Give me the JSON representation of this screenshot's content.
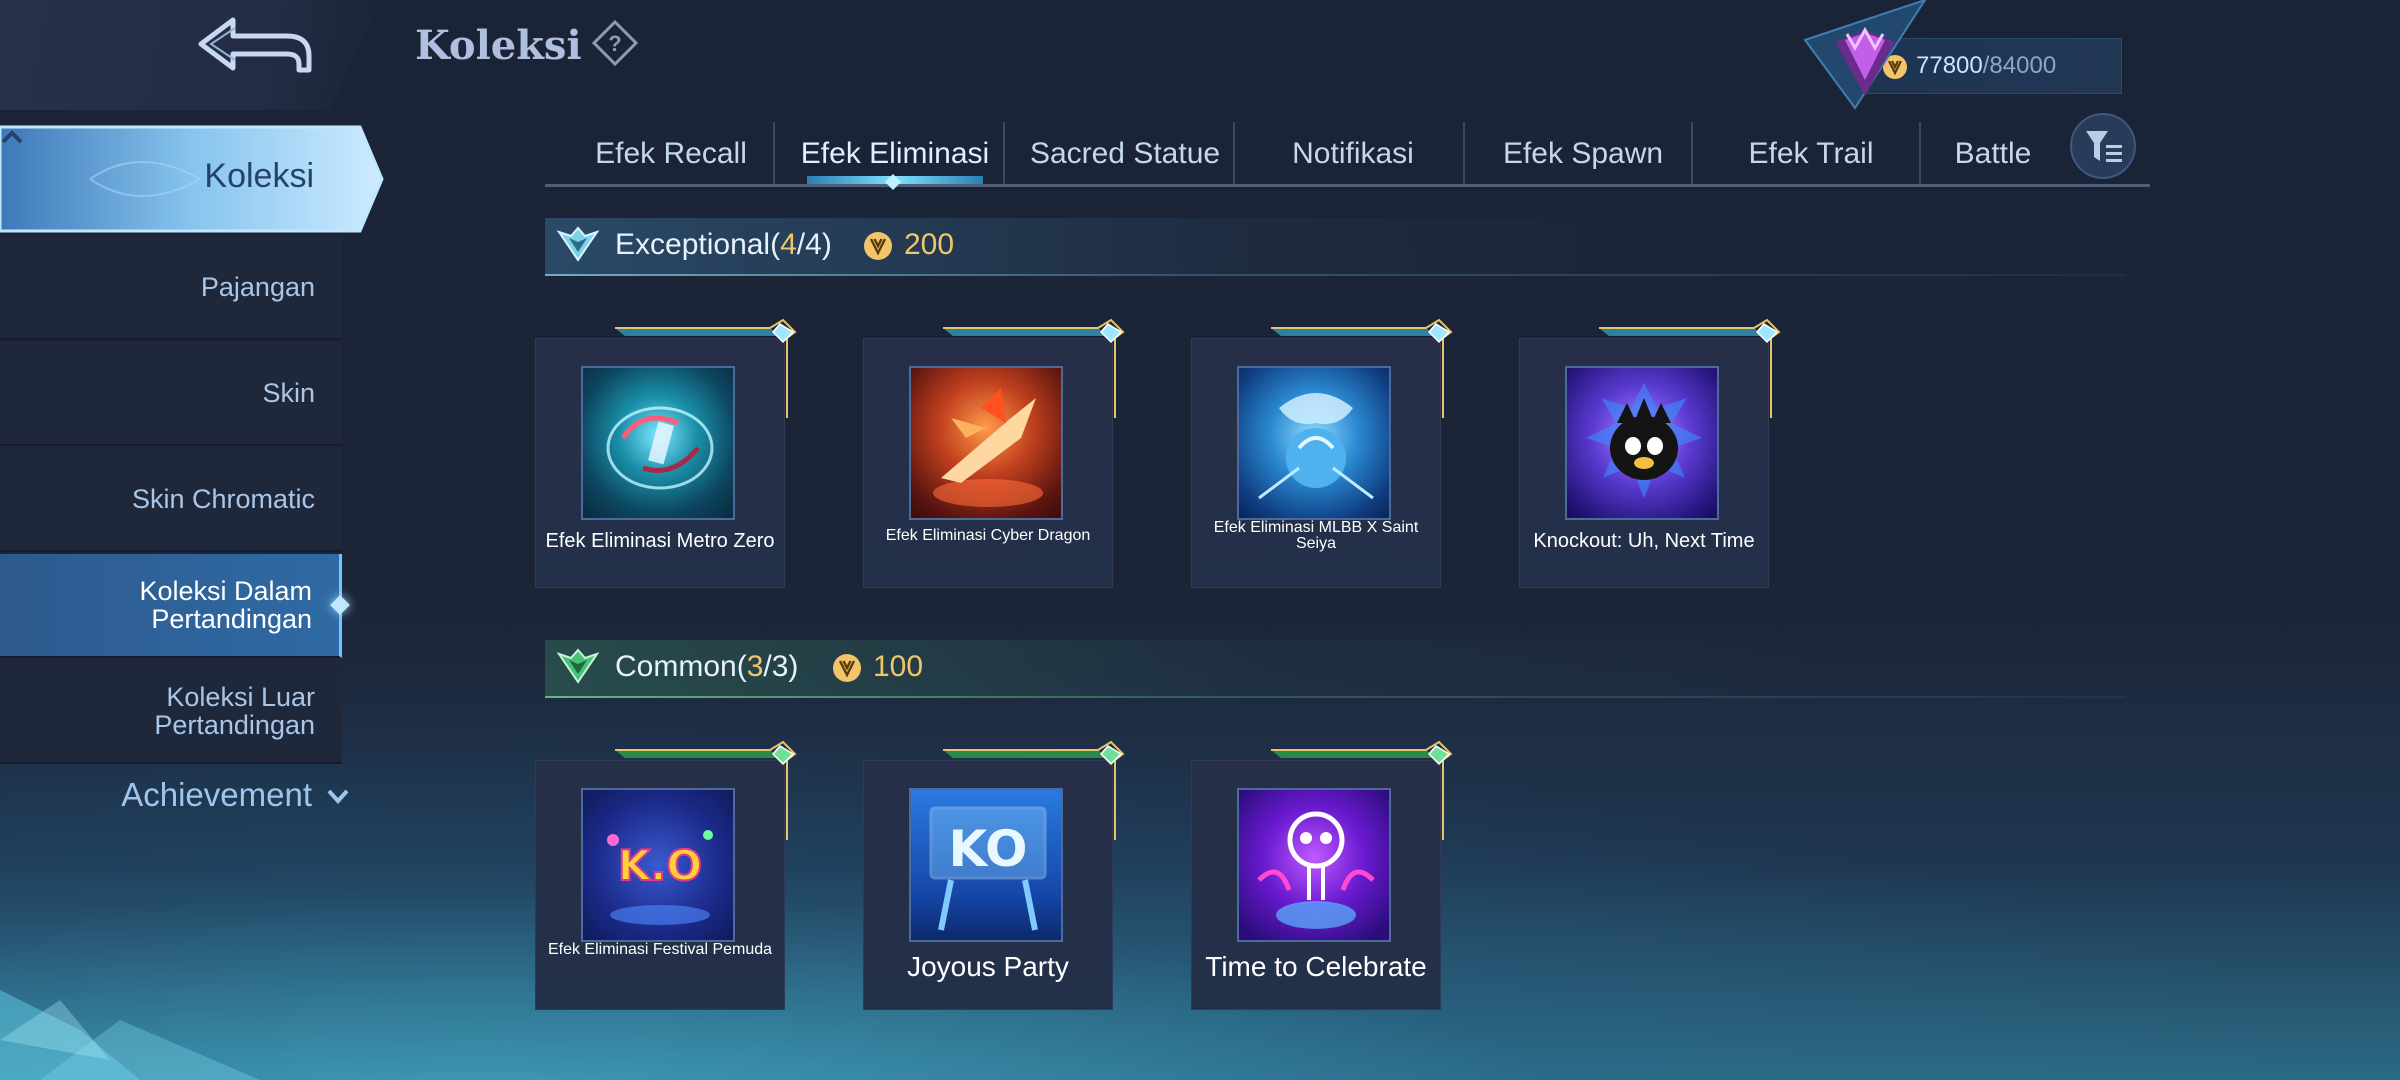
{
  "header": {
    "title": "Koleksi"
  },
  "currency": {
    "owned": "77800",
    "separator": "/",
    "total": "84000"
  },
  "sidebar": {
    "main": {
      "label": "Koleksi"
    },
    "items": [
      {
        "label": "Pajangan"
      },
      {
        "label": "Skin"
      },
      {
        "label": "Skin Chromatic"
      },
      {
        "label": "Koleksi Dalam\nPertandingan"
      },
      {
        "label": "Koleksi Luar\nPertandingan"
      }
    ],
    "achievement": {
      "label": "Achievement"
    }
  },
  "tabs": [
    {
      "label": "Efek Recall"
    },
    {
      "label": "Efek Eliminasi"
    },
    {
      "label": "Sacred Statue"
    },
    {
      "label": "Notifikasi"
    },
    {
      "label": "Efek Spawn"
    },
    {
      "label": "Efek Trail"
    },
    {
      "label": "Battle"
    }
  ],
  "sections": [
    {
      "title": "Exceptional",
      "count_open": "(",
      "owned": "4",
      "slash": "/",
      "total": "4",
      "count_close": ")",
      "cost": "200",
      "items": [
        {
          "name": "Efek Eliminasi Metro Zero"
        },
        {
          "name": "Efek Eliminasi Cyber Dragon"
        },
        {
          "name": "Efek Eliminasi MLBB X Saint Seiya"
        },
        {
          "name": "Knockout: Uh, Next Time"
        }
      ]
    },
    {
      "title": "Common",
      "count_open": "(",
      "owned": "3",
      "slash": "/",
      "total": "3",
      "count_close": ")",
      "cost": "100",
      "items": [
        {
          "name": "Efek Eliminasi Festival Pemuda",
          "thumb_text": "K.O"
        },
        {
          "name": "Joyous Party",
          "thumb_text": "KO"
        },
        {
          "name": "Time to Celebrate"
        }
      ]
    }
  ],
  "colors": {
    "accent_gold": "#f2c56a",
    "tab_text": "#c4d7ef",
    "active_item": "#2f6aa4"
  }
}
